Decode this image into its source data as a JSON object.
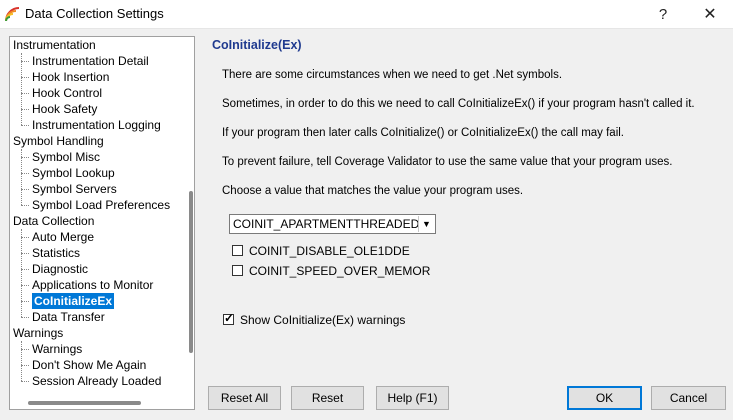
{
  "window": {
    "title": "Data Collection Settings",
    "help_glyph": "?",
    "close_glyph": "✕"
  },
  "tree": {
    "items": [
      {
        "label": "Instrumentation",
        "level": 0
      },
      {
        "label": "Instrumentation Detail",
        "level": 1
      },
      {
        "label": "Hook Insertion",
        "level": 1
      },
      {
        "label": "Hook Control",
        "level": 1
      },
      {
        "label": "Hook Safety",
        "level": 1
      },
      {
        "label": "Instrumentation Logging",
        "level": 1
      },
      {
        "label": "Symbol Handling",
        "level": 0
      },
      {
        "label": "Symbol Misc",
        "level": 1
      },
      {
        "label": "Symbol Lookup",
        "level": 1
      },
      {
        "label": "Symbol Servers",
        "level": 1
      },
      {
        "label": "Symbol Load Preferences",
        "level": 1
      },
      {
        "label": "Data Collection",
        "level": 0
      },
      {
        "label": "Auto Merge",
        "level": 1
      },
      {
        "label": "Statistics",
        "level": 1
      },
      {
        "label": "Diagnostic",
        "level": 1
      },
      {
        "label": "Applications to Monitor",
        "level": 1
      },
      {
        "label": "CoInitializeEx",
        "level": 1,
        "selected": true
      },
      {
        "label": "Data Transfer",
        "level": 1
      },
      {
        "label": "Warnings",
        "level": 0
      },
      {
        "label": "Warnings",
        "level": 1
      },
      {
        "label": "Don't Show Me Again",
        "level": 1
      },
      {
        "label": "Session Already Loaded",
        "level": 1
      }
    ]
  },
  "panel": {
    "title": "CoInitialize(Ex)",
    "paragraphs": [
      "There are some circumstances when we need to get .Net symbols.",
      "Sometimes, in order to do this we need to call CoInitializeEx() if your program hasn't called it.",
      "If your program then later calls CoInitialize() or CoInitializeEx() the call may fail.",
      "To prevent failure, tell Coverage Validator to use the same value that your program uses.",
      "Choose a value that matches the value your program uses."
    ],
    "combo_value": "COINIT_APARTMENTTHREADED",
    "option1_label": "COINIT_DISABLE_OLE1DDE",
    "option1_checked": false,
    "option2_label": "COINIT_SPEED_OVER_MEMOR",
    "option2_checked": false,
    "show_warnings_label": "Show CoInitialize(Ex) warnings",
    "show_warnings_checked": true
  },
  "buttons": {
    "reset_all": "Reset All",
    "reset": "Reset",
    "help": "Help (F1)",
    "ok": "OK",
    "cancel": "Cancel"
  },
  "icons": {
    "check_glyph": "✓",
    "dropdown_glyph": "▼"
  }
}
